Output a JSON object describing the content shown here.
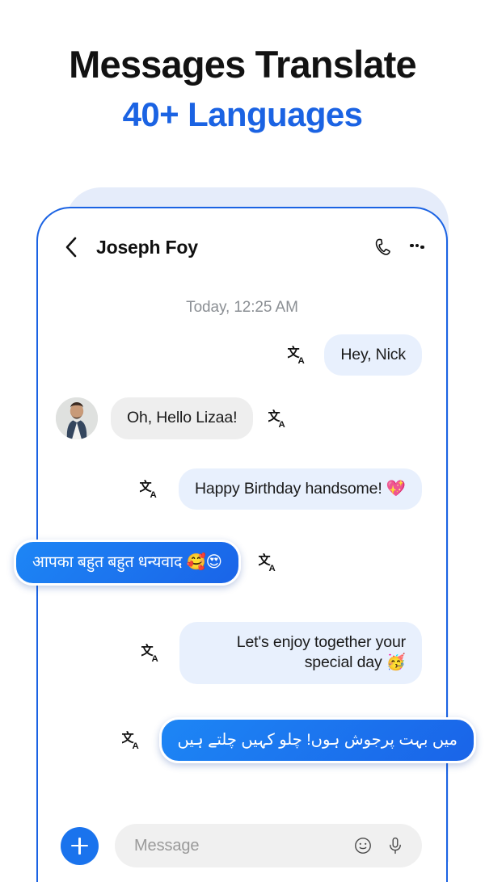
{
  "promo": {
    "headline": "Messages Translate",
    "subheadline": "40+ Languages",
    "accent_color": "#1b63e3",
    "headline_color": "#121212"
  },
  "chat": {
    "header": {
      "back_icon": "chevron-left-icon",
      "contact_name": "Joseph Foy",
      "call_icon": "phone-icon",
      "menu_icon": "more-vertical-icon"
    },
    "timestamp": "Today, 12:25 AM",
    "translate_icon": "translate-icon",
    "messages": [
      {
        "id": "msg-1",
        "text": "Hey, Nick",
        "side": "right",
        "style": "blue",
        "has_avatar": false,
        "has_translate_icon": true
      },
      {
        "id": "msg-2",
        "text": "Oh, Hello Lizaa!",
        "side": "left",
        "style": "grey",
        "has_avatar": true,
        "avatar_name": "contact-avatar",
        "has_translate_icon": true
      },
      {
        "id": "msg-3",
        "text": "Happy Birthday handsome! 💖",
        "side": "right",
        "style": "blue",
        "has_avatar": false,
        "has_translate_icon": true
      },
      {
        "id": "msg-4",
        "text": "आपका बहुत बहुत धन्यवाद 🥰😍",
        "side": "left",
        "style": "accent",
        "language": "Hindi",
        "has_avatar": false,
        "has_translate_icon": true
      },
      {
        "id": "msg-5",
        "text": "Let's enjoy together your special day 🥳",
        "side": "right",
        "style": "blue",
        "has_avatar": false,
        "has_translate_icon": true
      },
      {
        "id": "msg-6",
        "text": "میں بہت پرجوش ہوں! چلو کہیں چلتے ہیں",
        "side": "right",
        "style": "accent",
        "language": "Urdu",
        "has_avatar": false,
        "has_translate_icon": true
      }
    ],
    "input_bar": {
      "add_label": "+",
      "add_icon": "plus-icon",
      "placeholder": "Message",
      "emoji_icon": "smiley-icon",
      "mic_icon": "microphone-icon",
      "accent_color": "#1a73ed"
    }
  }
}
